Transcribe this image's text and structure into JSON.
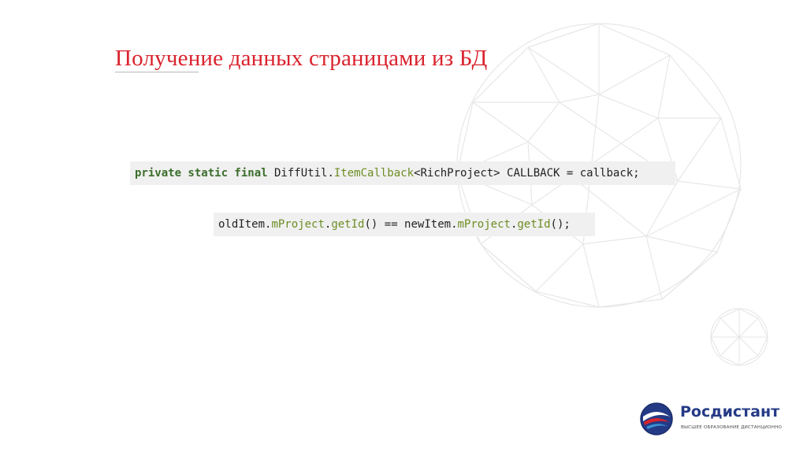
{
  "slide": {
    "title": "Получение данных страницами из БД"
  },
  "code_lines": {
    "line1": {
      "kw1": "private static final",
      "t1": " DiffUtil",
      "t2": ".",
      "m1": "ItemCallback",
      "t3": "<RichProject> CALLBACK = callback;"
    },
    "line2": {
      "t1": "oldItem",
      "t2": ".",
      "m1": "mProject",
      "t3": ".",
      "m2": "getId",
      "t4": "() == newItem",
      "t5": ".",
      "m3": "mProject",
      "t6": ".",
      "m4": "getId",
      "t7": "();"
    }
  },
  "logo": {
    "name": "Росдистант",
    "tagline": "ВЫСШЕЕ ОБРАЗОВАНИЕ ДИСТАНЦИОННО",
    "colors": {
      "blue": "#243a86",
      "red": "#d9232d",
      "light_blue": "#3b8fd1"
    }
  },
  "colors": {
    "title": "#d9232d",
    "code_bg": "#f0f0f0",
    "keyword": "#3b6e2c",
    "member": "#6d8d23"
  }
}
